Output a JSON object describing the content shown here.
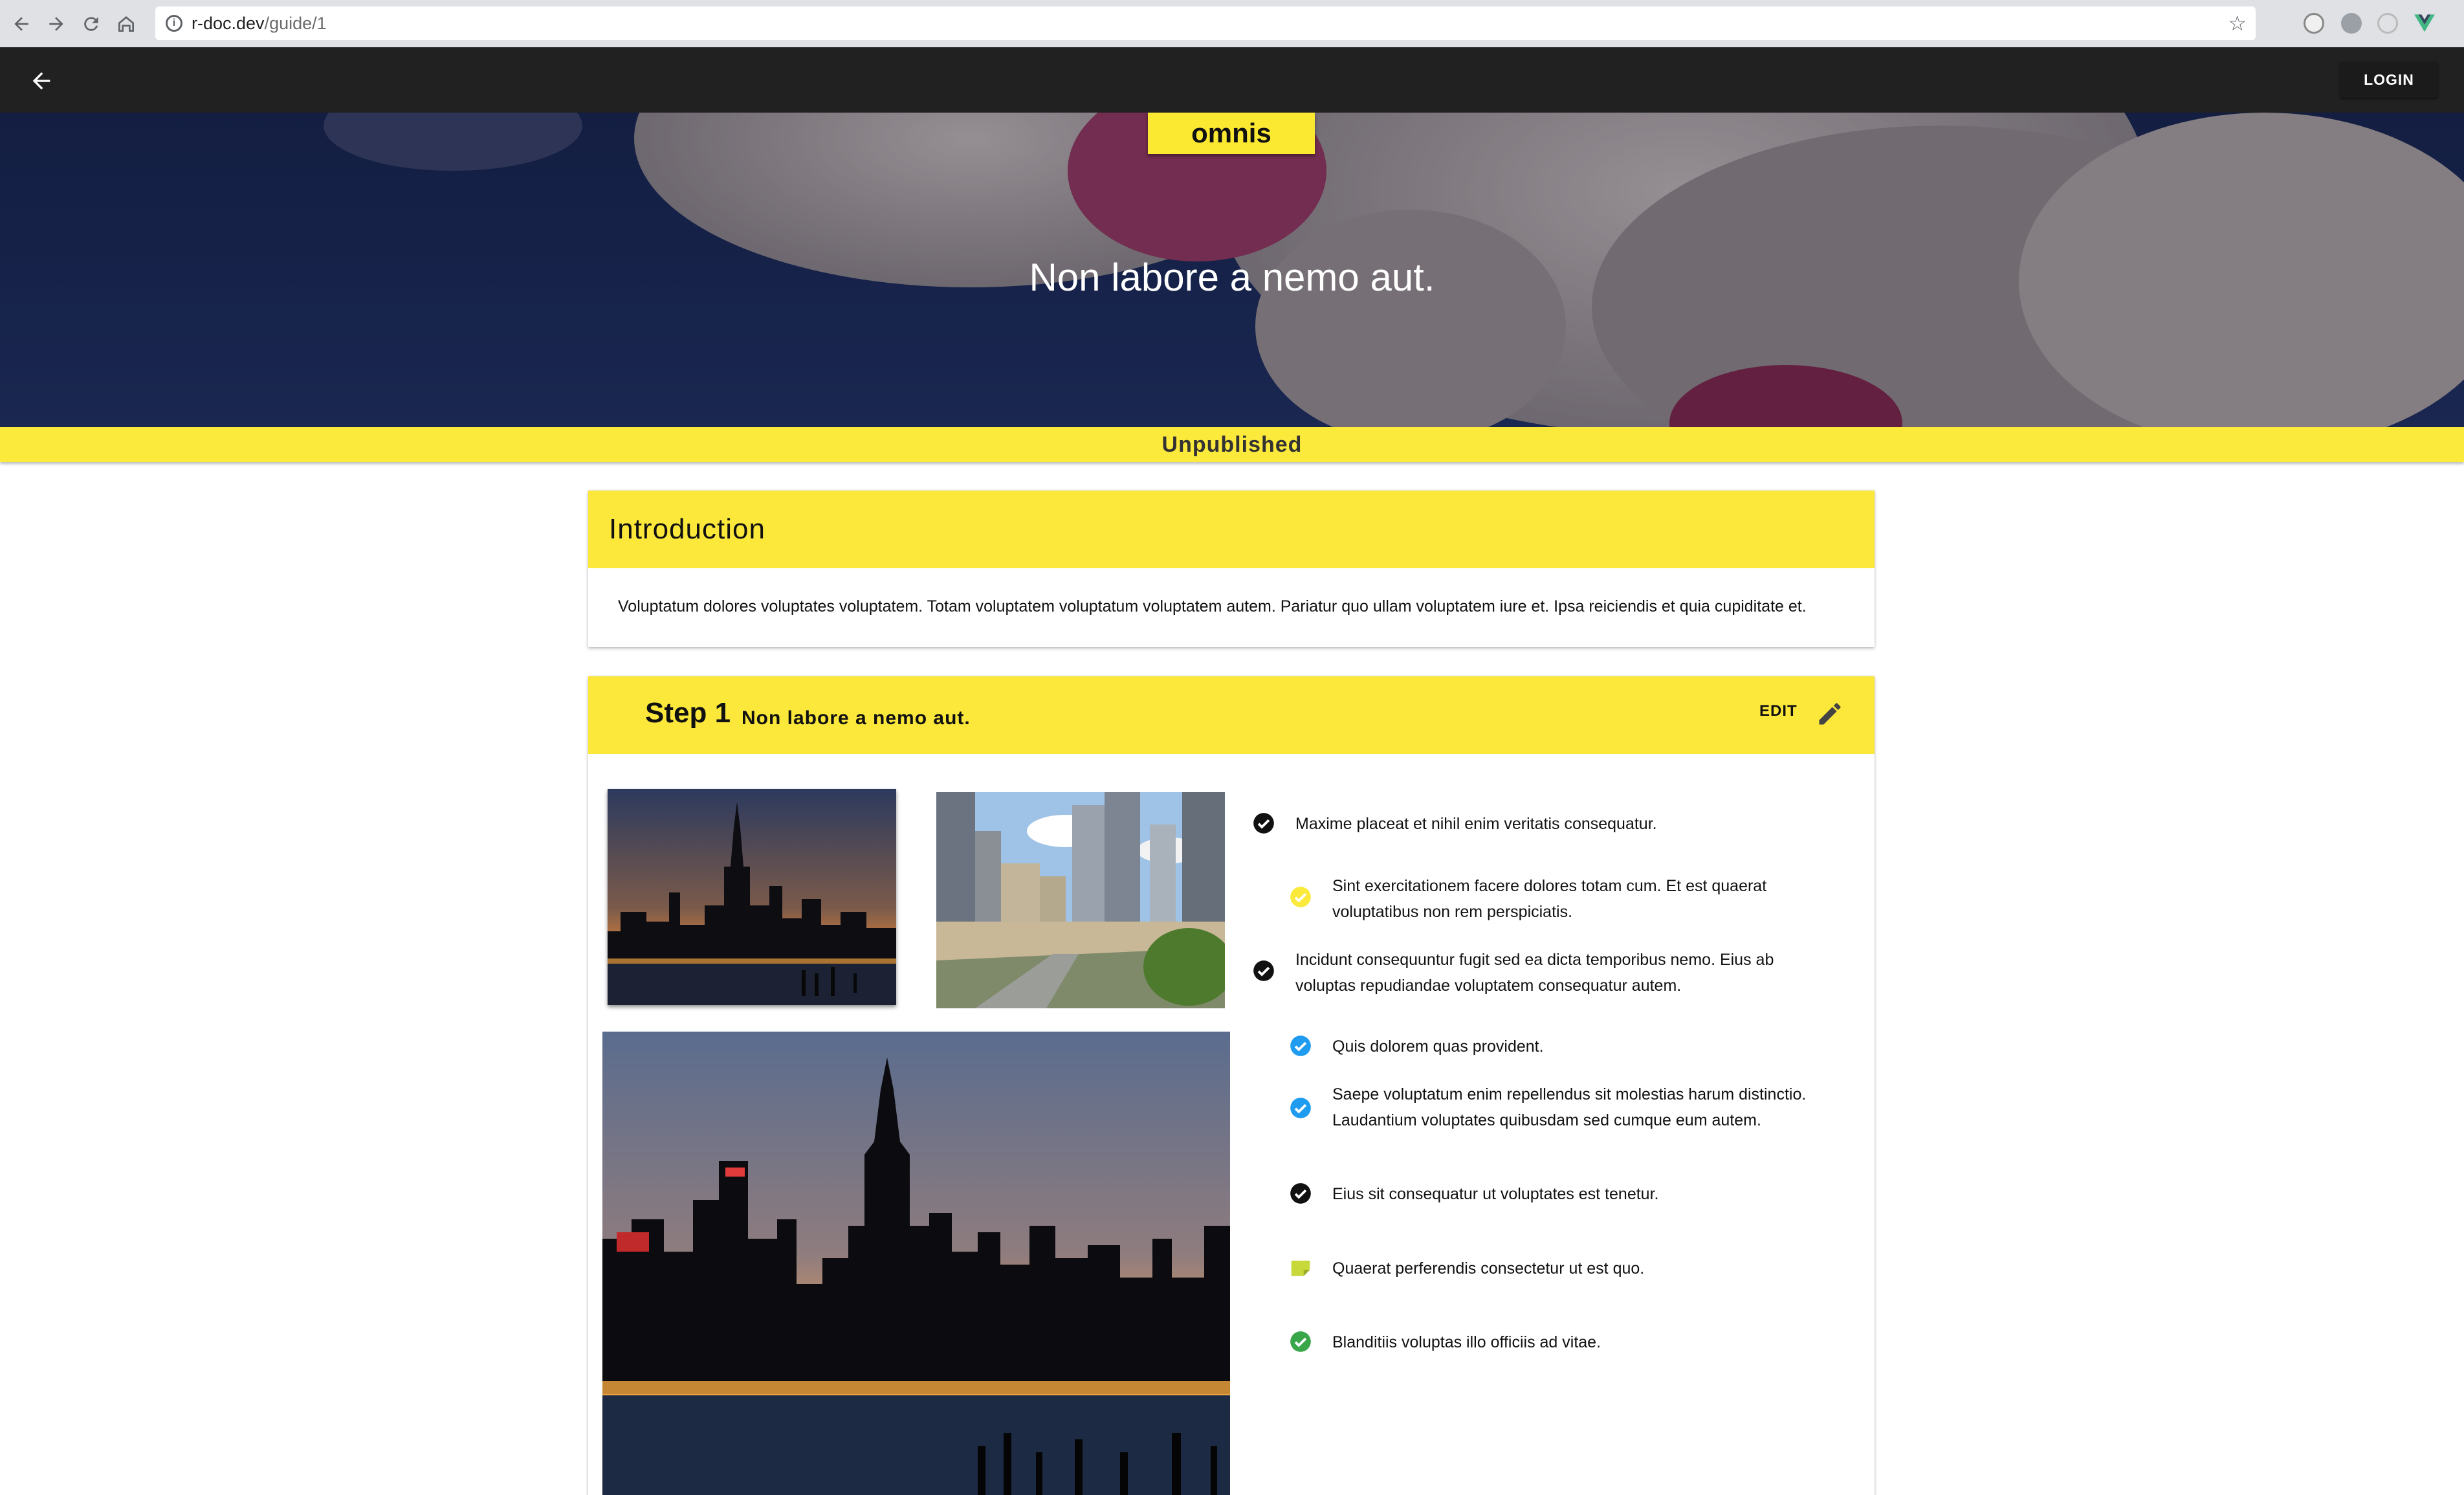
{
  "browser": {
    "url_host": "r-doc.dev",
    "url_path": "/guide/1"
  },
  "app_bar": {
    "login_label": "LOGIN"
  },
  "hero": {
    "category": "omnis",
    "title": "Non labore a nemo aut."
  },
  "status": {
    "label": "Unpublished"
  },
  "intro": {
    "title": "Introduction",
    "text": "Voluptatum dolores voluptates voluptatem. Totam voluptatem voluptatum voluptatem autem. Pariatur quo ullam voluptatem iure et. Ipsa reiciendis et quia cupiditate et."
  },
  "step": {
    "label": "Step 1",
    "title": "Non labore a nemo aut.",
    "edit_label": "EDIT",
    "bullets": [
      {
        "text": "Maxime placeat et nihil enim veritatis consequatur.",
        "icon": "check-circle-icon",
        "color": "#111111"
      },
      {
        "text": "Sint exercitationem facere dolores totam cum. Et est quaerat voluptatibus non rem perspiciatis.",
        "icon": "check-circle-icon",
        "color": "#fbe93c"
      },
      {
        "text": "Incidunt consequuntur fugit sed ea dicta temporibus nemo. Eius ab voluptas repudiandae voluptatem consequatur autem.",
        "icon": "check-circle-icon",
        "color": "#111111"
      },
      {
        "text": "Quis dolorem quas provident.",
        "icon": "check-circle-icon",
        "color": "#1f9bf0"
      },
      {
        "text": "Saepe voluptatum enim repellendus sit molestias harum distinctio. Laudantium voluptates quibusdam sed cumque eum autem.",
        "icon": "check-circle-icon",
        "color": "#1f9bf0"
      },
      {
        "text": "Eius sit consequatur ut voluptates est tenetur.",
        "icon": "check-circle-icon",
        "color": "#111111"
      },
      {
        "text": "Quaerat perferendis consectetur ut est quo.",
        "icon": "note-icon",
        "color": "#c6d83a"
      },
      {
        "text": "Blanditiis voluptas illo officiis ad vitae.",
        "icon": "check-circle-icon",
        "color": "#3aa64a"
      }
    ]
  }
}
